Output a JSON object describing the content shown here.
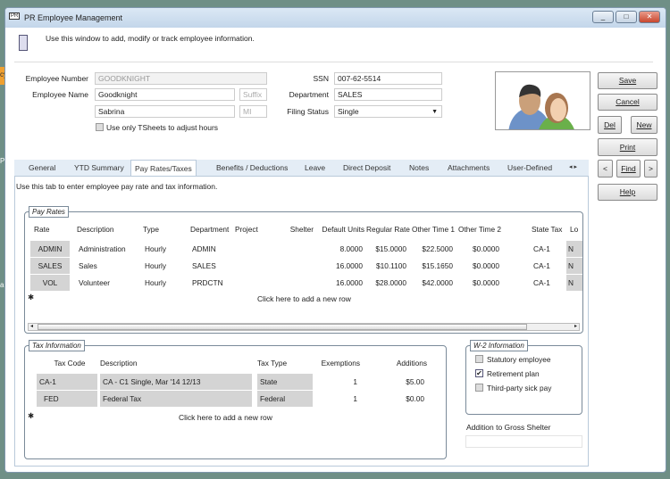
{
  "background_fragments": [
    "cy",
    "PS",
    "ar"
  ],
  "window": {
    "title": "PR Employee Management",
    "app_badge": "PR",
    "instruction": "Use this window to add, modify or track employee information."
  },
  "form": {
    "employee_number_label": "Employee Number",
    "employee_number": "GOODKNIGHT",
    "employee_name_label": "Employee Name",
    "last_name": "Goodknight",
    "suffix_placeholder": "Suffix",
    "first_name": "Sabrina",
    "mi_placeholder": "MI",
    "tsheets_label": "Use only TSheets to adjust hours",
    "tsheets_checked": false,
    "ssn_label": "SSN",
    "ssn": "007-62-5514",
    "department_label": "Department",
    "department": "SALES",
    "filing_status_label": "Filing Status",
    "filing_status": "Single"
  },
  "buttons": {
    "save": "Save",
    "cancel": "Cancel",
    "del": "Del",
    "new": "New",
    "print": "Print",
    "prev": "<",
    "find": "Find",
    "next": ">",
    "help": "Help"
  },
  "tabs": [
    {
      "label": "General"
    },
    {
      "label": "YTD Summary"
    },
    {
      "label": "Pay Rates/Taxes",
      "active": true
    },
    {
      "label": "Benefits / Deductions"
    },
    {
      "label": "Leave"
    },
    {
      "label": "Direct Deposit"
    },
    {
      "label": "Notes"
    },
    {
      "label": "Attachments"
    },
    {
      "label": "User-Defined"
    }
  ],
  "tab_instruction": "Use this tab to enter employee pay rate and tax information.",
  "pay_rates": {
    "title": "Pay Rates",
    "columns": [
      "Rate",
      "Description",
      "Type",
      "Department",
      "Project",
      "Shelter",
      "Default Units",
      "Regular Rate",
      "Other Time 1",
      "Other Time 2",
      "State Tax",
      "Lo"
    ],
    "rows": [
      [
        "ADMIN",
        "Administration",
        "Hourly",
        "ADMIN",
        "",
        "",
        "8.0000",
        "$15.0000",
        "$22.5000",
        "$0.0000",
        "CA-1",
        "N"
      ],
      [
        "SALES",
        "Sales",
        "Hourly",
        "SALES",
        "",
        "",
        "16.0000",
        "$10.1100",
        "$15.1650",
        "$0.0000",
        "CA-1",
        "N"
      ],
      [
        "VOL",
        "Volunteer",
        "Hourly",
        "PRDCTN",
        "",
        "",
        "16.0000",
        "$28.0000",
        "$42.0000",
        "$0.0000",
        "CA-1",
        "N"
      ]
    ],
    "add_row": "Click here to add a new row"
  },
  "tax_info": {
    "title": "Tax Information",
    "columns": [
      "Tax Code",
      "Description",
      "Tax Type",
      "Exemptions",
      "Additions"
    ],
    "rows": [
      [
        "CA-1",
        "CA - C1 Single, Mar '14 12/13",
        "State",
        "1",
        "$5.00"
      ],
      [
        "FED",
        "Federal Tax",
        "Federal",
        "1",
        "$0.00"
      ]
    ],
    "add_row": "Click here to add a new row"
  },
  "w2": {
    "title": "W-2 Information",
    "items": [
      {
        "label": "Statutory employee",
        "checked": false
      },
      {
        "label": "Retirement plan",
        "checked": true
      },
      {
        "label": "Third-party sick pay",
        "checked": false
      }
    ]
  },
  "addition_to_gross_shelter": {
    "label": "Addition to Gross Shelter",
    "value": ""
  }
}
